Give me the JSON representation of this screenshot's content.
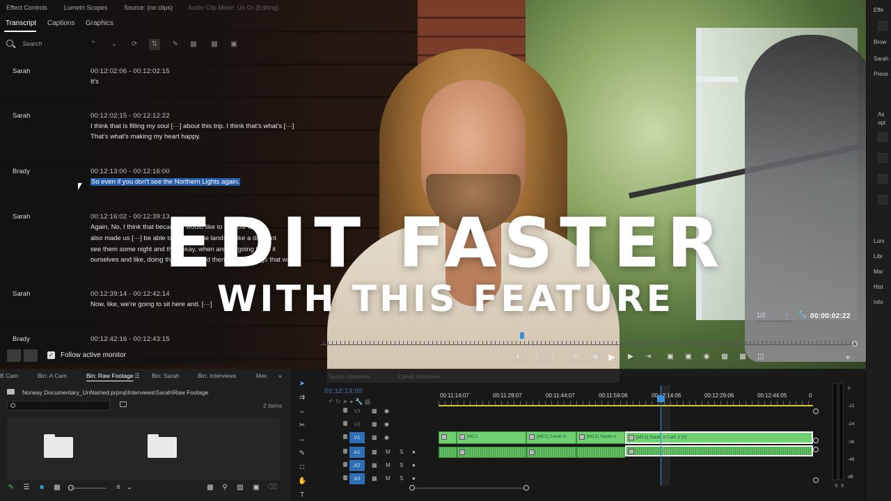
{
  "colors": {
    "accent": "#2f6fb5",
    "clip_green": "#71d072",
    "playhead": "#3b8fd6",
    "highlight": "#2a5fb0"
  },
  "transcript_panel": {
    "top_tabs": [
      "Effect Controls",
      "Lumetri Scopes",
      "Source: (no clips)",
      "Audio Clip Mixer: Un Or (Editing)"
    ],
    "tabs": [
      "Transcript",
      "Captions",
      "Graphics"
    ],
    "search_placeholder": "Search",
    "entries": [
      {
        "speaker": "Sarah",
        "time": "00:12:02:06 - 00:12:02:15",
        "lines": [
          "It's"
        ]
      },
      {
        "speaker": "Sarah",
        "time": "00:12:02:15 - 00:12:12:22",
        "lines": [
          "I think that is filling my soul [···] about this trip. I think that's what's [···]",
          "That's what's making my heart happy."
        ]
      },
      {
        "speaker": "Brady",
        "time": "00:12:13:00 - 00:12:16:00",
        "lines": [
          "So even if you don't see the Northern Lights again."
        ]
      },
      {
        "speaker": "Sarah",
        "time": "00:12:16:02 - 00:12:39:13",
        "lines": [
          "Again, No, I think that because I would like to be able to",
          "also made us [···] be able to make those lands in like a different",
          "see them some night and then okay, when are we going to do it",
          "ourselves and like, doing things right and then only do things that way"
        ]
      },
      {
        "speaker": "Sarah",
        "time": "00:12:39:14 - 00:12:42:14",
        "lines": [
          "Now, like, we're going to sit here and. [···]"
        ]
      },
      {
        "speaker": "Brady",
        "time": "00:12:42:16 - 00:12:43:15",
        "lines": []
      }
    ],
    "follow_label": "Follow active monitor",
    "follow_checked": true
  },
  "headline": {
    "line1": "EDIT FASTER",
    "line2": "WITH THIS FEATURE"
  },
  "right_panel": {
    "items": [
      "Effe",
      "Brow",
      "Sarah",
      "Prese",
      "As",
      "opt",
      "Lum",
      "Libr",
      "Mar",
      "Hist",
      "Info"
    ]
  },
  "program_monitor": {
    "zoom": "1/2",
    "timecode": "00:00:02:22"
  },
  "project_panel": {
    "tabs": [
      "B Cam",
      "Bin: A Cam",
      "Bin: Raw Footage",
      "Bin: Sarah",
      "Bin: Interviews",
      "Mec"
    ],
    "active_tab": "Bin: Raw Footage",
    "path": "Norway Documentary_UnNamed.prproj\\Interviews\\Sarah\\Raw Footage",
    "items_count": "2 items"
  },
  "timeline": {
    "tabs": [
      "Sarah Interview",
      "Clovis Interview"
    ],
    "timecode": "00:12:13:00",
    "ruler": [
      "00:11:14:07",
      "00:11:29:07",
      "00:11:44:07",
      "00:11:59:06",
      "00:12:14:06",
      "00:12:29:06",
      "00:12:44:05",
      "0"
    ],
    "video_tracks": [
      "V3",
      "V2",
      "V1"
    ],
    "audio_tracks": [
      "A1",
      "A2",
      "A3"
    ],
    "clip_labels": [
      "[MC1",
      "[MC1] Sarah A",
      "[MC1] Sarah A",
      "[MC1] Sarah A Cam 1 [V]"
    ],
    "track_letters": {
      "mute": "M",
      "solo": "S"
    }
  },
  "meters": {
    "scale": [
      "0",
      "-12",
      "-24",
      "-36",
      "-48",
      "dB"
    ],
    "solo": [
      "S",
      "S"
    ]
  }
}
